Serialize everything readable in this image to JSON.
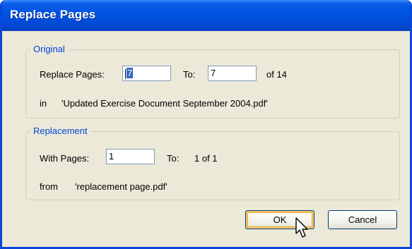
{
  "window": {
    "title": "Replace Pages"
  },
  "original": {
    "legend": "Original",
    "replace_pages_label": "Replace Pages:",
    "from_value": "7",
    "to_label": "To:",
    "to_value": "7",
    "of_total": "of 14",
    "in_label": "in",
    "document_name": "'Updated Exercise Document September 2004.pdf'"
  },
  "replacement": {
    "legend": "Replacement",
    "with_pages_label": "With Pages:",
    "with_value": "1",
    "to_label": "To:",
    "to_value": "1 of 1",
    "from_label": "from",
    "file_name": "'replacement page.pdf'"
  },
  "buttons": {
    "ok": "OK",
    "cancel": "Cancel"
  },
  "cursor_icon": "mouse-pointer-icon"
}
